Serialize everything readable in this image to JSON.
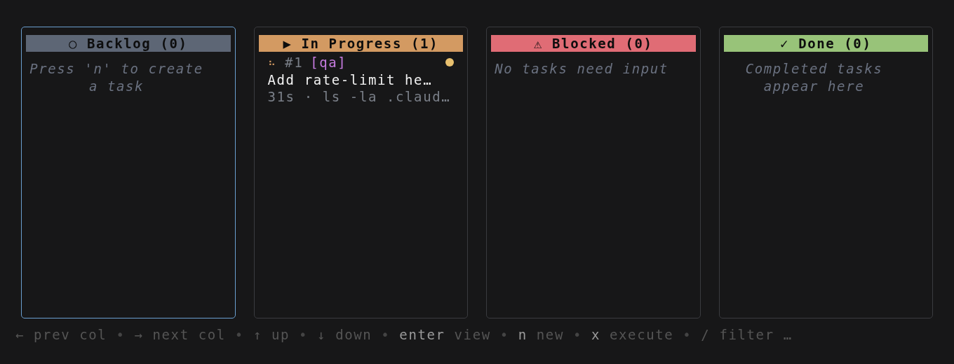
{
  "columns": [
    {
      "icon": "○",
      "title": "Backlog (0)",
      "color": "#5d6675",
      "selected": true,
      "empty_text": "Press 'n' to create a task"
    },
    {
      "icon": "▶",
      "title": "In Progress (1)",
      "color": "#d39a62",
      "selected": false,
      "tasks": [
        {
          "spinner": "⠦",
          "id": "#1",
          "tag": "[qa]",
          "color": "#e8c06e",
          "title": "Add rate-limit he…",
          "detail": "31s · ls -la .claud…"
        }
      ]
    },
    {
      "icon": "⚠",
      "title": "Blocked (0)",
      "color": "#e06c75",
      "selected": false,
      "empty_text": "No tasks need input"
    },
    {
      "icon": "✓",
      "title": "Done (0)",
      "color": "#98c379",
      "selected": false,
      "empty_text": "Completed tasks appear here"
    }
  ],
  "footer": [
    {
      "kind": "text",
      "text": "← prev col"
    },
    {
      "kind": "sep",
      "text": "•"
    },
    {
      "kind": "text",
      "text": "→ next col"
    },
    {
      "kind": "sep",
      "text": "•"
    },
    {
      "kind": "text",
      "text": "↑ up"
    },
    {
      "kind": "sep",
      "text": "•"
    },
    {
      "kind": "text",
      "text": "↓ down"
    },
    {
      "kind": "sep",
      "text": "•"
    },
    {
      "kind": "key",
      "text": "enter"
    },
    {
      "kind": "text",
      "text": "view"
    },
    {
      "kind": "sep",
      "text": "•"
    },
    {
      "kind": "key",
      "text": "n"
    },
    {
      "kind": "text",
      "text": "new"
    },
    {
      "kind": "sep",
      "text": "•"
    },
    {
      "kind": "key",
      "text": "x"
    },
    {
      "kind": "text",
      "text": "execute"
    },
    {
      "kind": "sep",
      "text": "•"
    },
    {
      "kind": "text",
      "text": "/ filter …"
    }
  ]
}
